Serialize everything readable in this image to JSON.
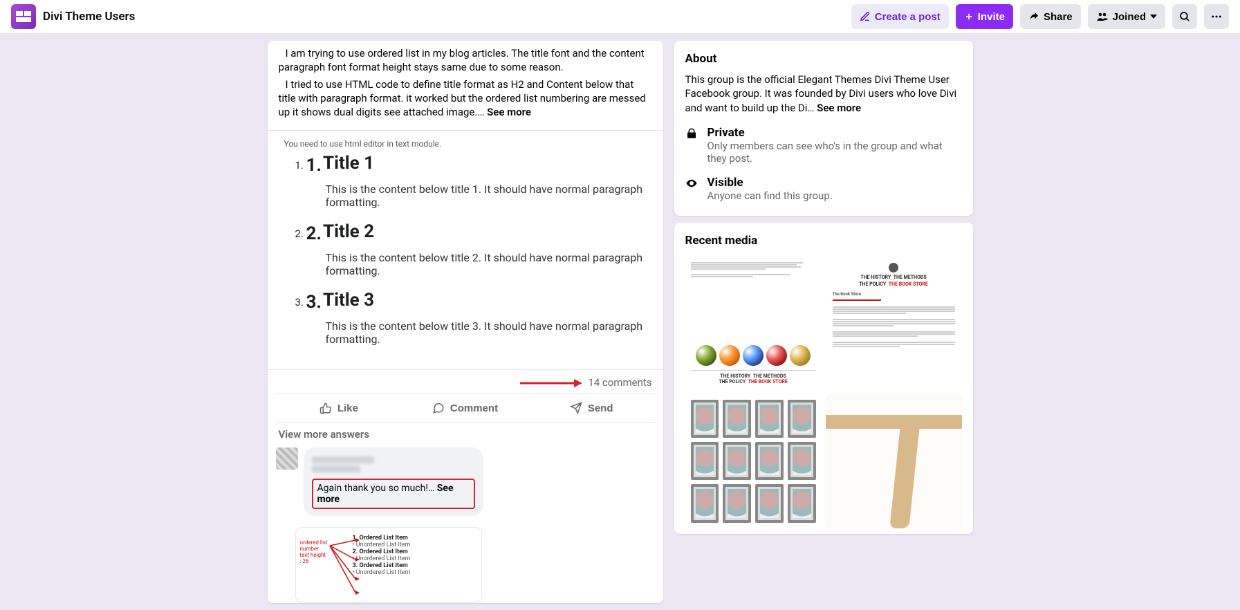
{
  "header": {
    "group_name": "Divi Theme Users",
    "create_post": "Create a post",
    "invite": "Invite",
    "share": "Share",
    "joined": "Joined"
  },
  "post": {
    "para1_indent": "I am trying to use ordered list in my blog articles. The title font and the content paragraph font format height stays same due to some reason.",
    "para2": "I tried to use HTML code to define title format as H2 and Content below that title with paragraph format. it worked but the ordered list numbering are messed up it shows dual digits see attached image.… ",
    "see_more": "See more",
    "attachment_hint": "You need to use html editor in text module.",
    "items": [
      {
        "num": "1.",
        "title": "Title 1",
        "desc": "This is the content below title 1. It should have normal paragraph formatting."
      },
      {
        "num": "2.",
        "title": "Title 2",
        "desc": "This is the content below title 2. It should have normal paragraph formatting."
      },
      {
        "num": "3.",
        "title": "Title 3",
        "desc": "This is the content below title 3. It should have normal paragraph formatting."
      }
    ],
    "comments_count": "14 comments",
    "actions": {
      "like": "Like",
      "comment": "Comment",
      "send": "Send"
    },
    "view_more": "View more answers",
    "reply_text": "Again thank you so much!… ",
    "reply_see_more": "See more",
    "reply_attach": {
      "side_label": "ordered list number text height : 26",
      "lines": [
        {
          "b": "1. Ordered List Item"
        },
        {
          "t": "• Unordered List Item"
        },
        {
          "b": "2. Ordered List Item"
        },
        {
          "t": "• Unordered List Item"
        },
        {
          "b": "3. Ordered List Item"
        },
        {
          "t": "• Unordered List Item"
        }
      ]
    }
  },
  "about": {
    "heading": "About",
    "desc": "This group is the official Elegant Themes Divi Theme User Facebook group. It was founded by Divi users who love Divi and want to build up the Di… ",
    "see_more": "See more",
    "private_label": "Private",
    "private_sub": "Only members can see who's in the group and what they post.",
    "visible_label": "Visible",
    "visible_sub": "Anyone can find this group."
  },
  "media": {
    "heading": "Recent media"
  },
  "doc_thumb": {
    "hd_a": "THE HISTORY",
    "hd_b": "THE METHODS",
    "hd_c": "THE POLICY",
    "hd_d": "THE BOOK STORE",
    "sub": "The Book Store"
  },
  "marbles_thumb": {
    "foot_a": "THE HISTORY",
    "foot_b": "THE METHODS",
    "foot_c": "THE POLICY",
    "foot_d": "THE BOOK STORE"
  }
}
